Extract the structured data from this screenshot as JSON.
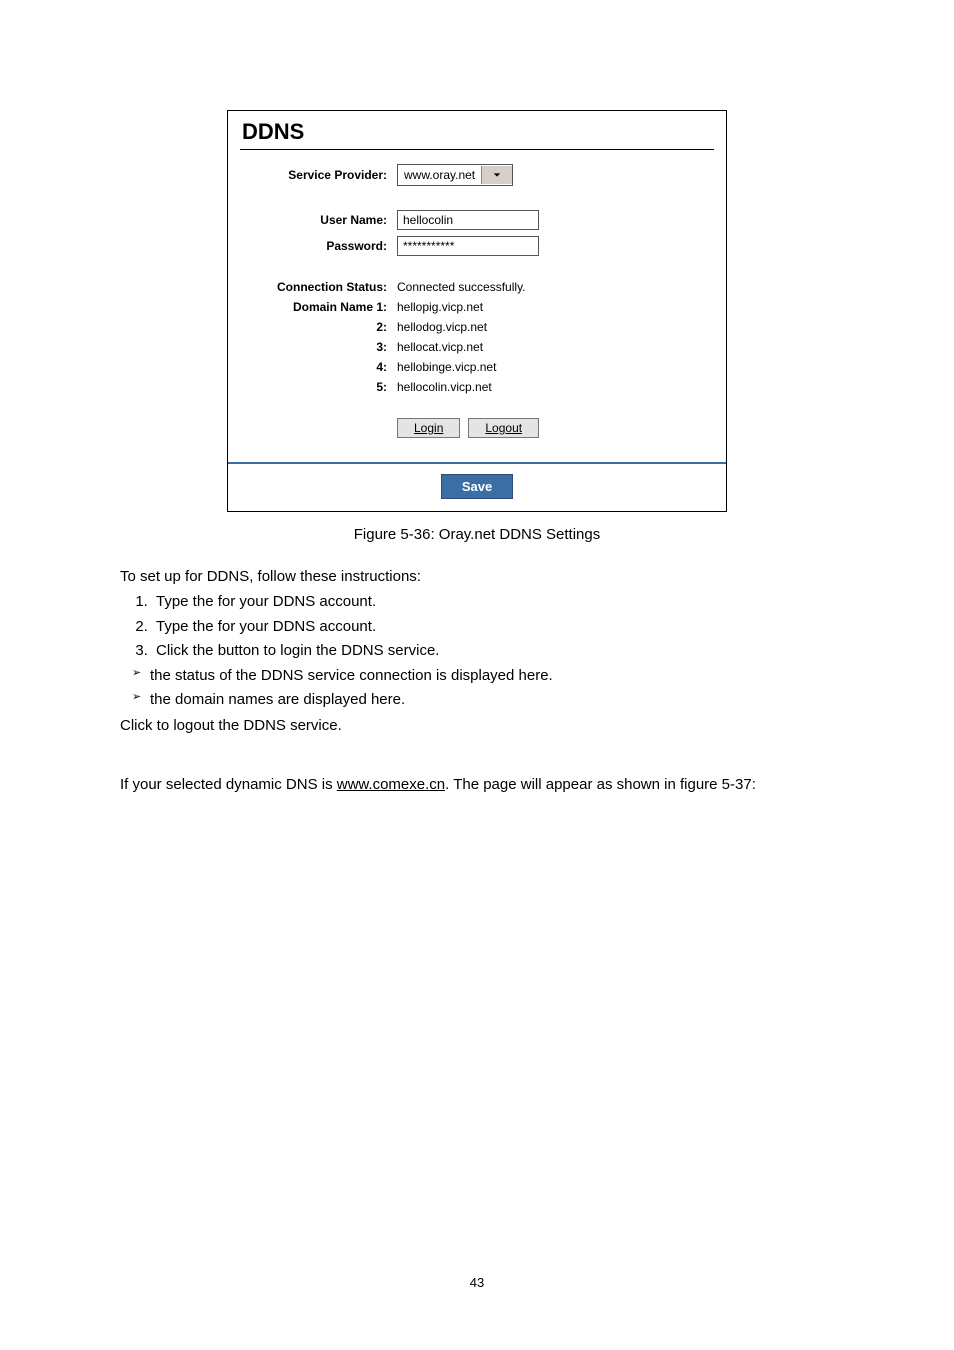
{
  "panel": {
    "title": "DDNS",
    "serviceProviderLabel": "Service Provider:",
    "serviceProviderValue": "www.oray.net",
    "userNameLabel": "User Name:",
    "userNameValue": "hellocolin",
    "passwordLabel": "Password:",
    "passwordValue": "***********",
    "connStatusLabel": "Connection Status:",
    "connStatusValue": "Connected successfully.",
    "domain1Label": "Domain Name 1:",
    "domain2Label": "2:",
    "domain3Label": "3:",
    "domain4Label": "4:",
    "domain5Label": "5:",
    "domain1": "hellopig.vicp.net",
    "domain2": "hellodog.vicp.net",
    "domain3": "hellocat.vicp.net",
    "domain4": "hellobinge.vicp.net",
    "domain5": "hellocolin.vicp.net",
    "loginBtn": "Login",
    "logoutBtn": "Logout",
    "saveBtn": "Save"
  },
  "caption": "Figure 5-36: Oray.net DDNS Settings",
  "intro": "To set up for DDNS, follow these instructions:",
  "step1a": "Type the ",
  "step1b": " for your DDNS account.",
  "step2a": "Type the ",
  "step2b": " for your DDNS account.",
  "step3a": "Click the ",
  "step3b": " button to login the DDNS service.",
  "bullet1": " the status of the DDNS service connection is displayed here.",
  "bullet2": " the domain names are displayed here.",
  "afterA": "Click ",
  "afterB": " to logout the DDNS service.",
  "para2a": "If your selected dynamic DNS ",
  "para2b": " is ",
  "para2link": "www.comexe.cn",
  "para2c": ". The page will appear as shown in figure 5-37:",
  "pageNum": "43"
}
